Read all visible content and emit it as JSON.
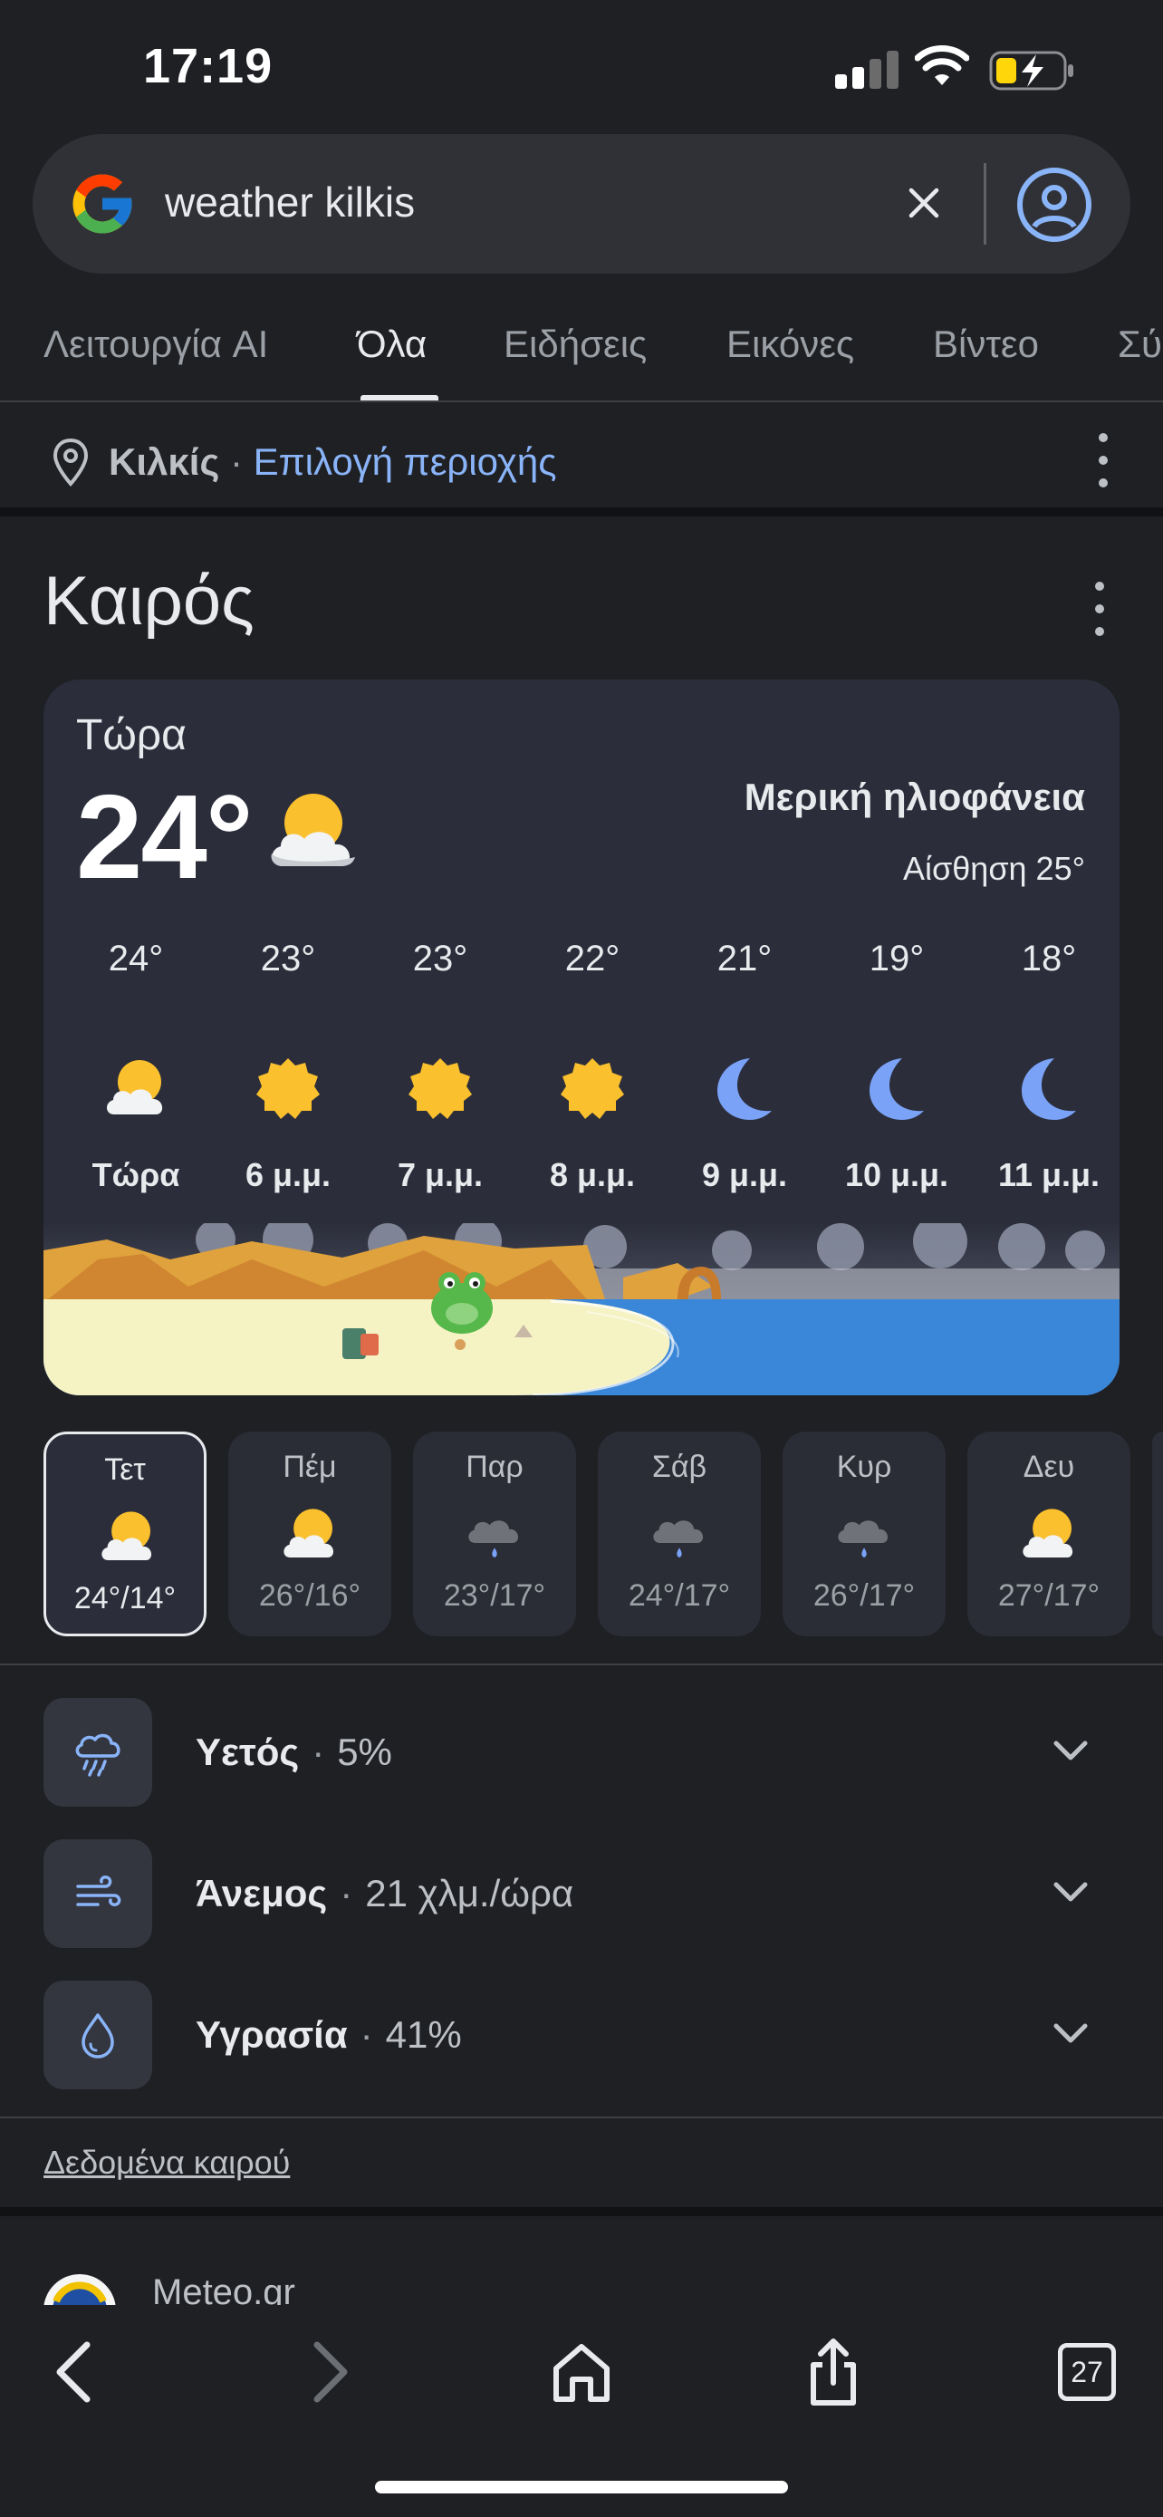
{
  "status_bar": {
    "time": "17:19"
  },
  "search": {
    "query": "weather kilkis"
  },
  "tabs": [
    {
      "label": "Λειτουργία AI",
      "active": false
    },
    {
      "label": "Όλα",
      "active": true
    },
    {
      "label": "Ειδήσεις",
      "active": false
    },
    {
      "label": "Εικόνες",
      "active": false
    },
    {
      "label": "Βίντεο",
      "active": false
    },
    {
      "label": "Σύ",
      "active": false
    }
  ],
  "location": {
    "name": "Κιλκίς",
    "separator": "·",
    "link": "Επιλογή περιοχής"
  },
  "weather": {
    "title": "Καιρός",
    "now_label": "Τώρα",
    "temperature": "24°",
    "condition": "Μερική ηλιοφάνεια",
    "feels_like": "Αίσθηση 25°",
    "hourly": [
      {
        "temp": "24°",
        "icon": "partly-cloudy-icon",
        "label": "Τώρα"
      },
      {
        "temp": "23°",
        "icon": "sun-icon",
        "label": "6 μ.μ."
      },
      {
        "temp": "23°",
        "icon": "sun-icon",
        "label": "7 μ.μ."
      },
      {
        "temp": "22°",
        "icon": "sun-icon",
        "label": "8 μ.μ."
      },
      {
        "temp": "21°",
        "icon": "moon-icon",
        "label": "9 μ.μ."
      },
      {
        "temp": "19°",
        "icon": "moon-icon",
        "label": "10 μ.μ."
      },
      {
        "temp": "18°",
        "icon": "moon-icon",
        "label": "11 μ.μ."
      }
    ],
    "daily": [
      {
        "day": "Τετ",
        "icon": "partly-cloudy-icon",
        "temps": "24°/14°",
        "selected": true
      },
      {
        "day": "Πέμ",
        "icon": "partly-cloudy-icon",
        "temps": "26°/16°",
        "selected": false
      },
      {
        "day": "Παρ",
        "icon": "rain-cloud-icon",
        "temps": "23°/17°",
        "selected": false
      },
      {
        "day": "Σάβ",
        "icon": "rain-cloud-icon",
        "temps": "24°/17°",
        "selected": false
      },
      {
        "day": "Κυρ",
        "icon": "rain-cloud-icon",
        "temps": "26°/17°",
        "selected": false
      },
      {
        "day": "Δευ",
        "icon": "partly-cloudy-icon",
        "temps": "27°/17°",
        "selected": false
      }
    ],
    "details": [
      {
        "label": "Υετός",
        "value": "5%",
        "icon": "precipitation-icon"
      },
      {
        "label": "Άνεμος",
        "value": "21 χλμ./ώρα",
        "icon": "wind-icon"
      },
      {
        "label": "Υγρασία",
        "value": "41%",
        "icon": "humidity-icon"
      }
    ],
    "detail_separator": "·",
    "data_link": "Δεδομένα καιρού"
  },
  "next_result": {
    "title": "Meteo.gr"
  },
  "toolbar": {
    "tab_count": "27"
  },
  "colors": {
    "background": "#1f2024",
    "card": "#2b2d3a",
    "link": "#8ab4f8",
    "sun": "#fbc02d",
    "moon": "#7aa2f7"
  }
}
